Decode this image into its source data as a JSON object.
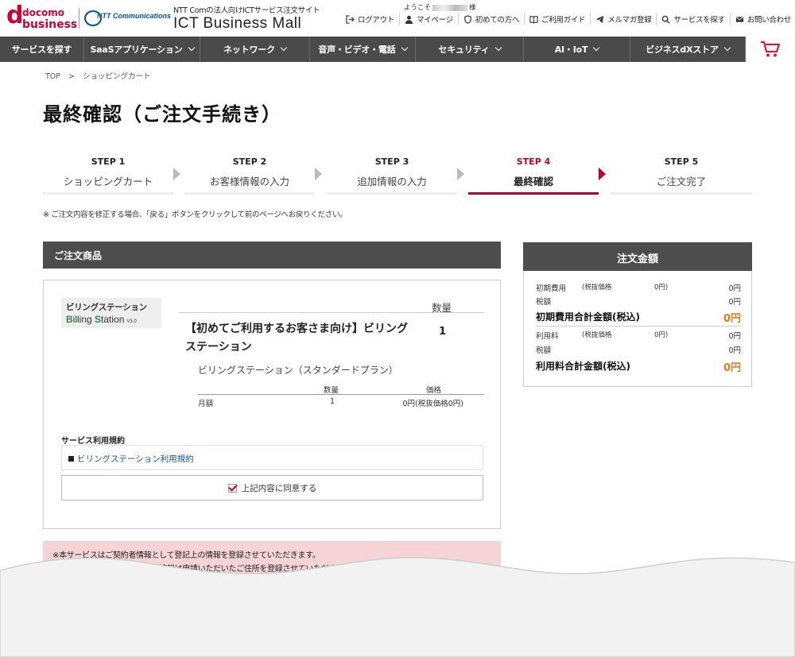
{
  "brand": {
    "docomo_d": "d",
    "docomo": "docomo",
    "business": "business",
    "ntt": "NTT Communications",
    "site_sub": "NTT Comの法人向けICTサービス注文サイト",
    "site_title": "ICT Business Mall"
  },
  "user": {
    "welcome_prefix": "ようこそ",
    "welcome_suffix": "様"
  },
  "util_nav": [
    {
      "label": "ログアウト",
      "icon": "logout-icon"
    },
    {
      "label": "マイページ",
      "icon": "user-icon"
    },
    {
      "label": "初めての方へ",
      "icon": "shield-icon"
    },
    {
      "label": "ご利用ガイド",
      "icon": "book-icon"
    },
    {
      "label": "メルマガ登録",
      "icon": "paper-plane-icon"
    },
    {
      "label": "サービスを探す",
      "icon": "search-icon"
    },
    {
      "label": "お問い合わせ",
      "icon": "mail-icon"
    }
  ],
  "main_nav": [
    {
      "label": "サービスを探す"
    },
    {
      "label": "SaaSアプリケーション"
    },
    {
      "label": "ネットワーク"
    },
    {
      "label": "音声・ビデオ・電話"
    },
    {
      "label": "セキュリティ"
    },
    {
      "label": "AI・IoT"
    },
    {
      "label": "ビジネスdXストア"
    }
  ],
  "breadcrumb": {
    "home": "TOP",
    "sep": ">",
    "current": "ショッピングカート"
  },
  "page_title": "最終確認（ご注文手続き）",
  "steps": [
    {
      "num": "STEP 1",
      "label": "ショッピングカート"
    },
    {
      "num": "STEP 2",
      "label": "お客様情報の入力"
    },
    {
      "num": "STEP 3",
      "label": "追加情報の入力"
    },
    {
      "num": "STEP 4",
      "label": "最終確認"
    },
    {
      "num": "STEP 5",
      "label": "ご注文完了"
    }
  ],
  "notice": "※ ご注文内容を修正する場合、「戻る」ボタンをクリックして前のページへお戻りください。",
  "order": {
    "heading": "ご注文商品",
    "logo_jp": "ビリングステーション",
    "logo_en_b1": "B",
    "logo_en_1": "illing ",
    "logo_en_b2": "S",
    "logo_en_2": "tation",
    "logo_ver": "V3.0",
    "qty_header": "数量",
    "product_name": "【初めてご利用するお客さま向け】ビリングステーション",
    "product_qty": "1",
    "plan_name": "ビリングステーション（スタンダードプラン）",
    "plan_table": {
      "headers": [
        "",
        "数量",
        "価格"
      ],
      "rows": [
        {
          "item": "月額",
          "qty": "1",
          "price": "0円(税抜価格0円)"
        }
      ]
    },
    "terms_title": "サービス利用規約",
    "terms_link": "ビリングステーション利用規約",
    "agree_label": "上記内容に同意する",
    "agree_checked": true
  },
  "notes": [
    "※本サービスはご契約者情報として登記上の情報を登録させていただきます。",
    "※　　　　　　　　　　　　請情報は申請いただいたご住所を登録させていただきます。"
  ],
  "summary": {
    "heading": "注文金額",
    "initial_fee_label": "初期費用",
    "initial_fee_note": "(税抜価格",
    "initial_fee_note_val": "0円)",
    "initial_fee": "0円",
    "tax_label": "税額",
    "initial_tax": "0円",
    "initial_total_label": "初期費用合計金額(税込)",
    "initial_total": "0円",
    "usage_fee_label": "利用料",
    "usage_fee_note": "(税抜価格",
    "usage_fee_note_val": "0円)",
    "usage_fee": "0円",
    "usage_tax": "0円",
    "usage_total_label": "利用料合計金額(税込)",
    "usage_total": "0円"
  },
  "colors": {
    "accent": "#c0002a",
    "nav_bg": "#4a4a4a",
    "total": "#e8791a",
    "link": "#1d4f9a",
    "notice_bg": "#f5d3d6"
  }
}
